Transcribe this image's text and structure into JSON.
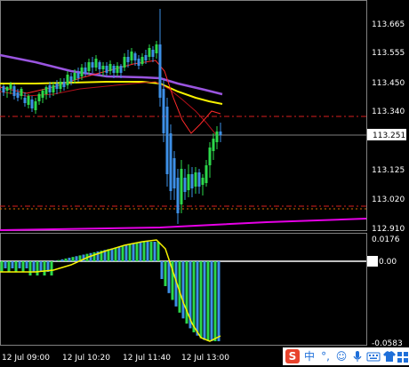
{
  "colors": {
    "background": "#000000",
    "bull_candle": "#2cd84a",
    "bear_candle": "#3d8fe6",
    "ma_fast": "#ff2a2a",
    "ma_medium": "#b3101a",
    "ma_yellow": "#f7f200",
    "ma_purple": "#9a55e0",
    "level_line": "#d81e1e",
    "level_line_dotted": "#d87000",
    "current_price_line": "#808080",
    "magenta_line": "#e600e6",
    "histogram_positive": "#2cd84a",
    "histogram_negative": "#3d8fe6",
    "signal_line": "#f7f200"
  },
  "price_axis": {
    "labels": [
      "113.665",
      "113.555",
      "113.450",
      "113.340",
      "113.125",
      "113.020",
      "112.910"
    ],
    "current_price": "113.251"
  },
  "indicator_axis": {
    "labels": [
      "0.0176",
      "0.00",
      "-0.0583"
    ]
  },
  "time_axis": {
    "labels": [
      "12 Jul 09:00",
      "12 Jul 10:20",
      "12 Jul 11:40",
      "12 Jul 13:00"
    ]
  },
  "tray": {
    "ime_icon": "sogou-s-icon",
    "lang_label": "中",
    "punct_label": "°,",
    "emoji_label": "☺",
    "mic_icon": "microphone-icon",
    "keyboard_icon": "keyboard-icon",
    "shirt_icon": "skin-shirt-icon",
    "grid_icon": "toolbox-grid-icon"
  }
}
